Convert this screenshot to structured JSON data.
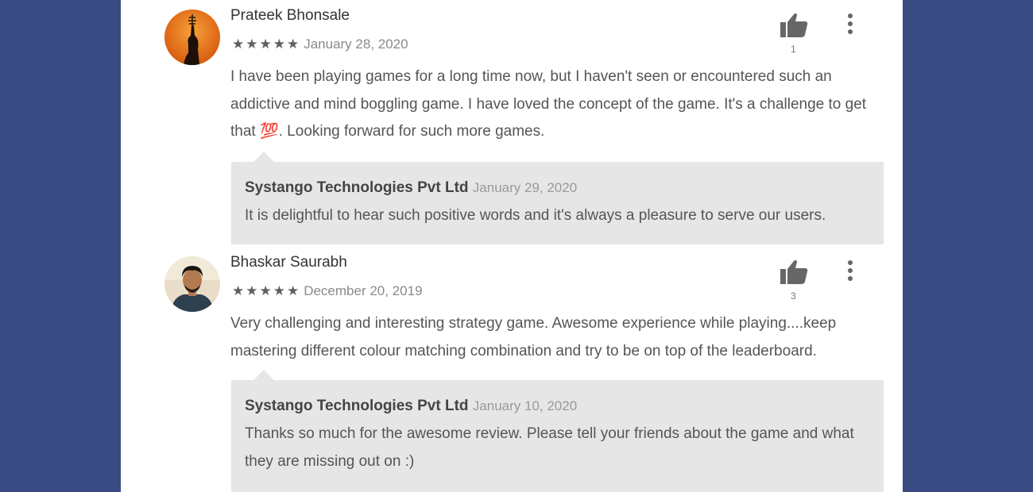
{
  "reviews": [
    {
      "author": "Prateek Bhonsale",
      "stars": "★★★★★",
      "rating": 5,
      "date": "January 28, 2020",
      "text": "I have been playing games for a long time now, but I haven't seen or encountered such an addictive and mind boggling game. I have loved the concept of the game. It's a challenge to get that 💯. Looking forward for such more games.",
      "likes": "1",
      "thumb_icon": "thumbs-up-icon",
      "more_icon": "more-vertical-icon",
      "reply": {
        "author": "Systango Technologies Pvt Ltd",
        "date": "January 29, 2020",
        "text": "It is delightful to hear such positive words and it's always a pleasure to serve our users."
      }
    },
    {
      "author": "Bhaskar Saurabh",
      "stars": "★★★★★",
      "rating": 5,
      "date": "December 20, 2019",
      "text": "Very challenging and interesting strategy game. Awesome experience while playing....keep mastering different colour matching combination and try to be on top of the leaderboard.",
      "likes": "3",
      "thumb_icon": "thumbs-up-icon",
      "more_icon": "more-vertical-icon",
      "reply": {
        "author": "Systango Technologies Pvt Ltd",
        "date": "January 10, 2020",
        "text": "Thanks so much for the awesome review. Please tell your friends about the game and what they are missing out on :)"
      }
    }
  ],
  "colors": {
    "background": "#3a4a82",
    "panel": "#ffffff",
    "reply_bg": "#e6e6e6"
  }
}
